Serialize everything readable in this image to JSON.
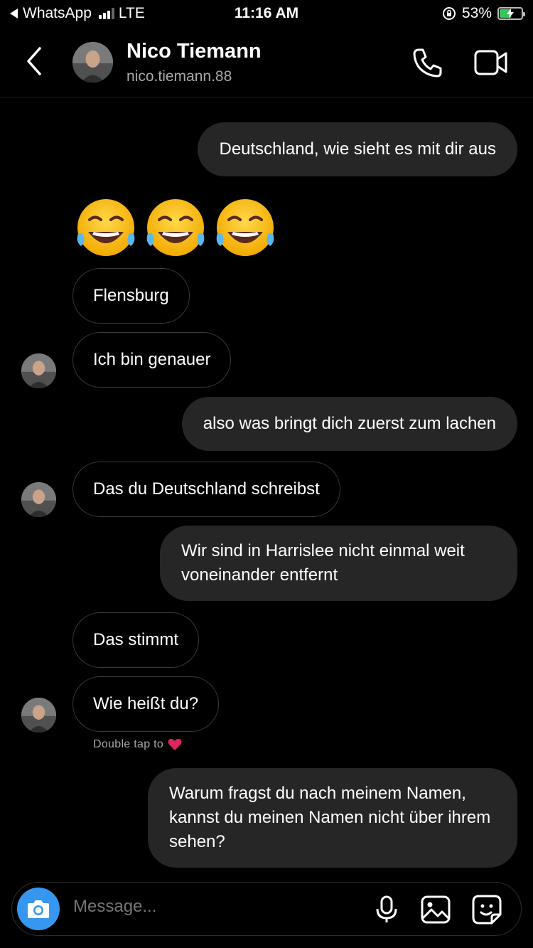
{
  "status_bar": {
    "back_app": "WhatsApp",
    "network": "LTE",
    "time": "11:16 AM",
    "battery": "53%",
    "battery_level": 0.53
  },
  "header": {
    "name": "Nico Tiemann",
    "handle": "nico.tiemann.88"
  },
  "messages": [
    {
      "side": "sent",
      "text": "Deutschland, wie sieht es mit dir aus"
    },
    {
      "side": "received",
      "type": "emoji",
      "text": "😂😂😂"
    },
    {
      "side": "received",
      "text": "Flensburg"
    },
    {
      "side": "received",
      "text": "Ich bin genauer"
    },
    {
      "side": "sent",
      "text": "also was bringt dich zuerst zum lachen"
    },
    {
      "side": "received",
      "text": "Das du Deutschland schreibst"
    },
    {
      "side": "sent",
      "text": "Wir sind in Harrislee nicht einmal weit voneinander entfernt"
    },
    {
      "side": "received",
      "text": "Das stimmt"
    },
    {
      "side": "received",
      "text": "Wie heißt du?"
    },
    {
      "side": "sent",
      "text": "Warum fragst du nach meinem Namen, kannst du meinen Namen nicht über ihrem sehen?"
    }
  ],
  "double_tap_hint": "Double tap to",
  "composer": {
    "placeholder": "Message..."
  },
  "colors": {
    "background": "#000000",
    "sent_bubble": "#262626",
    "received_border": "#3a3a3c",
    "camera_button": "#3797f0",
    "battery_fill": "#34c759"
  },
  "icons": [
    "back-arrow-icon",
    "signal-bars-icon",
    "orientation-lock-icon",
    "battery-charging-icon",
    "chevron-left-icon",
    "phone-icon",
    "video-camera-icon",
    "heart-icon",
    "camera-icon",
    "microphone-icon",
    "gallery-icon",
    "sticker-icon"
  ]
}
